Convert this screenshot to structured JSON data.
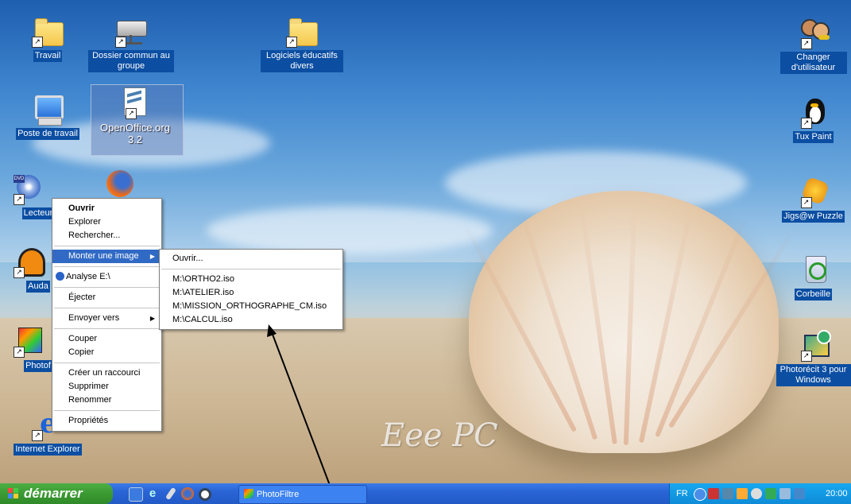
{
  "desktop": {
    "brand": "Eee PC",
    "icons_left": [
      {
        "label": "Travail",
        "icon": "folder-icon"
      },
      {
        "label": "Dossier commun au groupe",
        "icon": "network-drive-icon"
      },
      {
        "label": "Logiciels éducatifs divers",
        "icon": "folder-icon"
      },
      {
        "label": "Poste de travail",
        "icon": "computer-icon"
      },
      {
        "label": "OpenOffice.org 3.2",
        "icon": "openoffice-icon"
      },
      {
        "label": "Lecteur",
        "icon": "dvd-drive-icon"
      },
      {
        "label": "Auda",
        "icon": "audacity-icon"
      },
      {
        "label": "Photof",
        "icon": "photofiltre-icon"
      },
      {
        "label": "Internet Explorer",
        "icon": "internet-explorer-icon"
      }
    ],
    "icons_right": [
      {
        "label": "Changer d'utilisateur",
        "icon": "users-key-icon"
      },
      {
        "label": "Tux Paint",
        "icon": "tux-icon"
      },
      {
        "label": "Jigs@w Puzzle",
        "icon": "puzzle-icon"
      },
      {
        "label": "Corbeille",
        "icon": "recycle-bin-icon"
      },
      {
        "label": "Photorécit 3 pour Windows",
        "icon": "photorecit-icon"
      }
    ]
  },
  "context_menu": {
    "items": [
      {
        "label": "Ouvrir"
      },
      {
        "label": "Explorer"
      },
      {
        "label": "Rechercher..."
      },
      {
        "label": "Monter une image"
      },
      {
        "label": "Analyse E:\\"
      },
      {
        "label": "Éjecter"
      },
      {
        "label": "Envoyer vers"
      },
      {
        "label": "Couper"
      },
      {
        "label": "Copier"
      },
      {
        "label": "Créer un raccourci"
      },
      {
        "label": "Supprimer"
      },
      {
        "label": "Renommer"
      },
      {
        "label": "Propriétés"
      }
    ]
  },
  "submenu": {
    "items": [
      {
        "label": "Ouvrir..."
      },
      {
        "label": "M:\\ORTHO2.iso"
      },
      {
        "label": "M:\\ATELIER.iso"
      },
      {
        "label": "M:\\MISSION_ORTHOGRAPHE_CM.iso"
      },
      {
        "label": "M:\\CALCUL.iso"
      }
    ]
  },
  "taskbar": {
    "start_label": "démarrer",
    "task_label": "PhotoFiltre",
    "tray_lang": "FR",
    "clock": "20:00"
  }
}
